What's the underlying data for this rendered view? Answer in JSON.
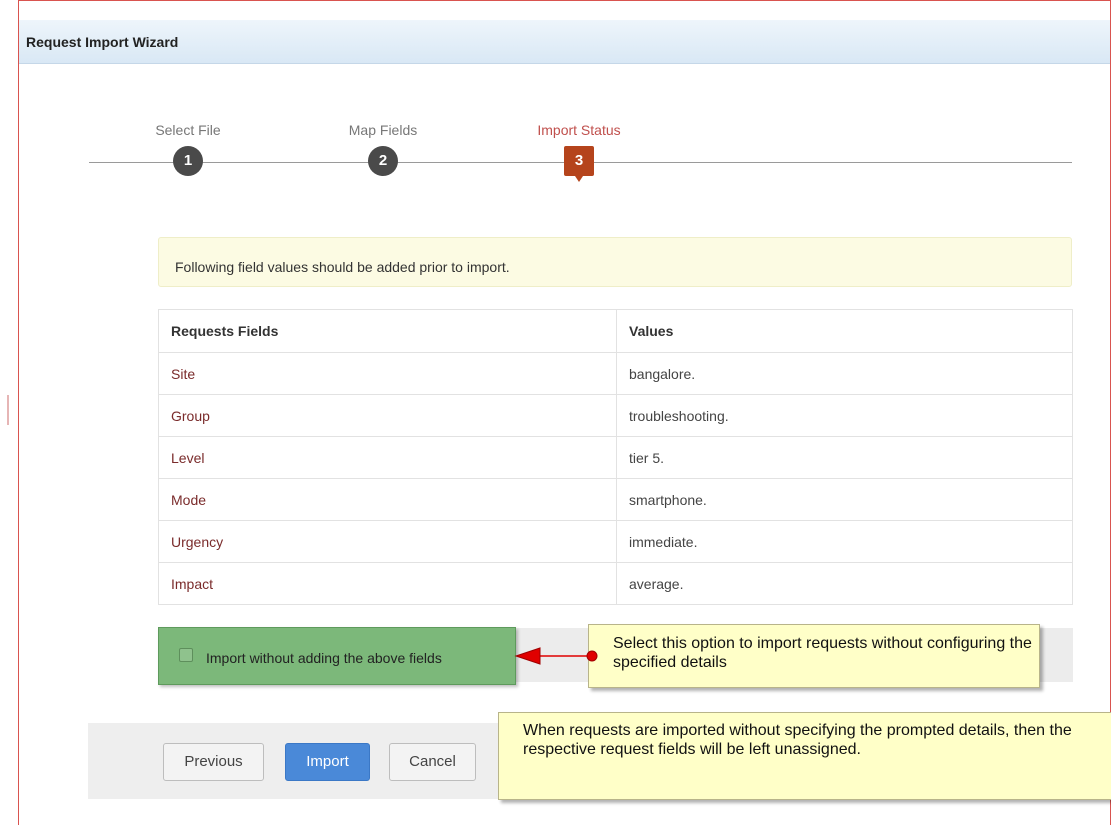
{
  "window": {
    "title": "Request Import Wizard"
  },
  "steps": [
    {
      "label": "Select File",
      "number": "1",
      "state": "done"
    },
    {
      "label": "Map Fields",
      "number": "2",
      "state": "done"
    },
    {
      "label": "Import Status",
      "number": "3",
      "state": "active"
    }
  ],
  "notice": {
    "text": "Following field values should be added prior to import."
  },
  "table": {
    "headers": [
      "Requests Fields",
      "Values"
    ],
    "rows": [
      {
        "field": "Site",
        "value": "bangalore."
      },
      {
        "field": "Group",
        "value": "troubleshooting."
      },
      {
        "field": "Level",
        "value": "tier 5."
      },
      {
        "field": "Mode",
        "value": "smartphone."
      },
      {
        "field": "Urgency",
        "value": "immediate."
      },
      {
        "field": "Impact",
        "value": "average."
      }
    ]
  },
  "option": {
    "label": "Import without adding the above fields",
    "checked": false
  },
  "callouts": {
    "option_hint": "Select this option to import requests without configuring the specified details",
    "import_hint": "When requests are imported without specifying the prompted details, then the respective request fields will be left unassigned."
  },
  "buttons": {
    "previous": "Previous",
    "import": "Import",
    "cancel": "Cancel"
  },
  "colors": {
    "active_step": "#b5441c",
    "import_button": "#4a89d8",
    "option_highlight": "#7cb87a",
    "callout_bg": "#ffffc8",
    "arrow": "#e00000"
  }
}
